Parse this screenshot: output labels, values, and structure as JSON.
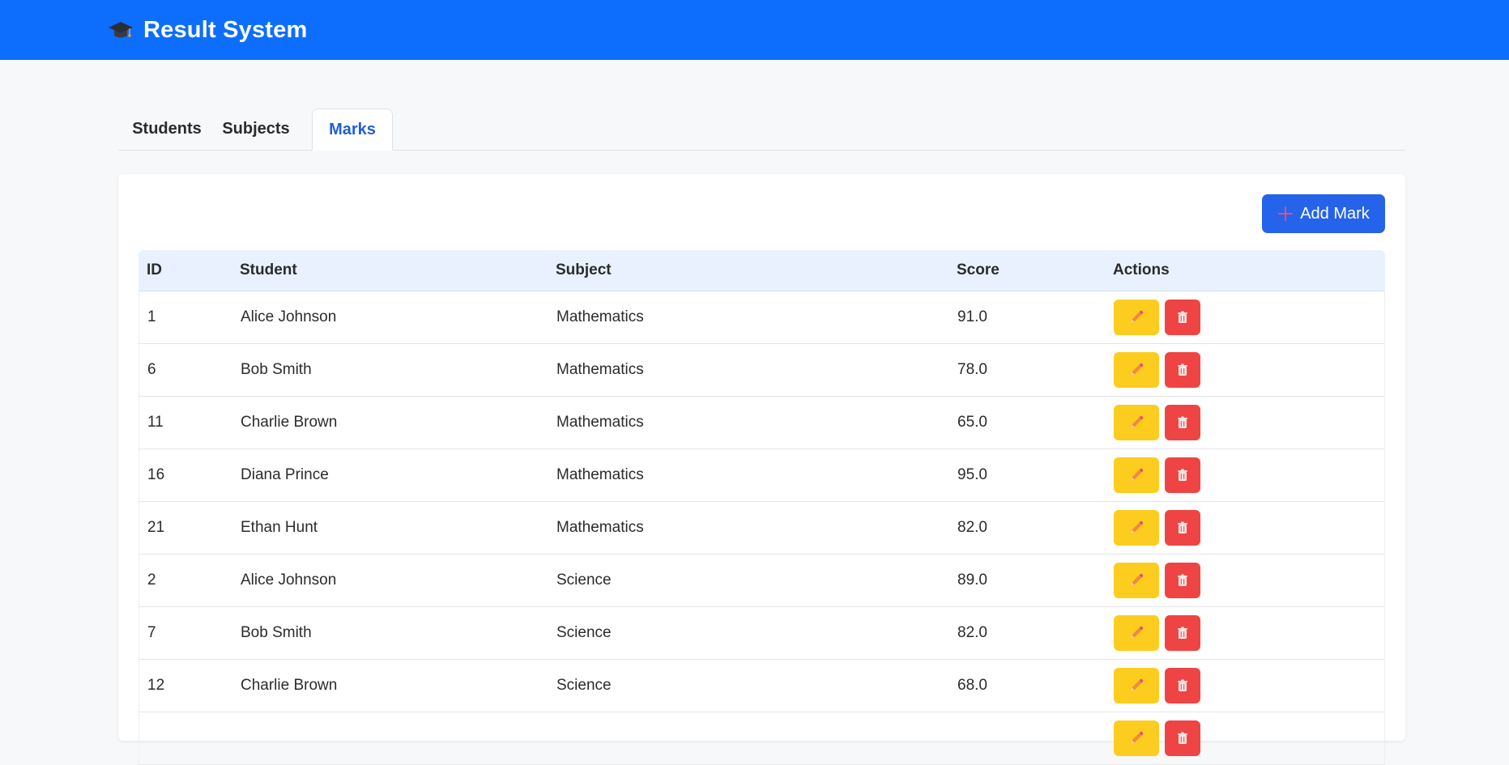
{
  "header": {
    "brand_icon": "graduation-cap-icon",
    "title": "Result System",
    "color": "#0d6efd"
  },
  "tabs": [
    {
      "label": "Students",
      "active": false
    },
    {
      "label": "Subjects",
      "active": false
    },
    {
      "label": "Marks",
      "active": true
    }
  ],
  "toolbar": {
    "add_label": "Add Mark",
    "add_icon": "plus-icon"
  },
  "table": {
    "columns": [
      "ID",
      "Student",
      "Subject",
      "Score",
      "Actions"
    ],
    "rows": [
      {
        "id": "1",
        "student": "Alice Johnson",
        "subject": "Mathematics",
        "score": "91.0"
      },
      {
        "id": "6",
        "student": "Bob Smith",
        "subject": "Mathematics",
        "score": "78.0"
      },
      {
        "id": "11",
        "student": "Charlie Brown",
        "subject": "Mathematics",
        "score": "65.0"
      },
      {
        "id": "16",
        "student": "Diana Prince",
        "subject": "Mathematics",
        "score": "95.0"
      },
      {
        "id": "21",
        "student": "Ethan Hunt",
        "subject": "Mathematics",
        "score": "82.0"
      },
      {
        "id": "2",
        "student": "Alice Johnson",
        "subject": "Science",
        "score": "89.0"
      },
      {
        "id": "7",
        "student": "Bob Smith",
        "subject": "Science",
        "score": "82.0"
      },
      {
        "id": "12",
        "student": "Charlie Brown",
        "subject": "Science",
        "score": "68.0"
      },
      {
        "id": "",
        "student": "",
        "subject": "",
        "score": ""
      }
    ],
    "row_actions": {
      "edit_icon": "pencil-icon",
      "delete_icon": "trash-icon",
      "edit_color": "#fccd1e",
      "delete_color": "#ef4444"
    }
  }
}
